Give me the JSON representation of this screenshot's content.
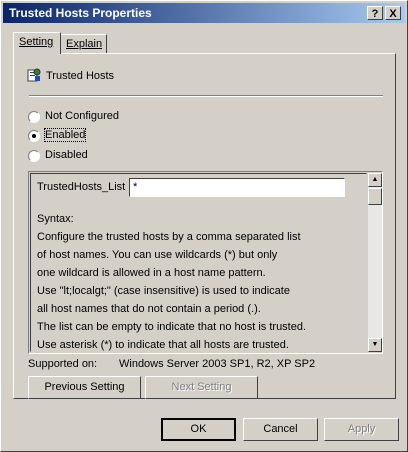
{
  "window": {
    "title": "Trusted Hosts Properties",
    "help_button": "?",
    "close_button": "X"
  },
  "tabs": [
    {
      "label": "Setting",
      "active": true
    },
    {
      "label": "Explain",
      "active": false
    }
  ],
  "policy": {
    "name": "Trusted Hosts",
    "icon": "policy-setting-icon"
  },
  "radios": [
    {
      "label": "Not Configured",
      "selected": false
    },
    {
      "label": "Enabled",
      "selected": true
    },
    {
      "label": "Disabled",
      "selected": false
    }
  ],
  "option": {
    "label": "TrustedHosts_List",
    "value": "*"
  },
  "description": [
    "Syntax:",
    "Configure the trusted hosts by a comma separated list",
    "of host names. You can use wildcards (*) but only",
    "one wildcard is allowed in a host name pattern.",
    "Use \"lt;localgt;\" (case insensitive) is used to indicate",
    "all host names that do not contain a period (.).",
    "The list can be empty to indicate that no host is trusted.",
    "Use asterisk (*)  to indicate that all hosts are trusted."
  ],
  "supported": {
    "label": "Supported on:",
    "value": "Windows Server 2003 SP1, R2, XP SP2"
  },
  "nav": {
    "previous": "Previous Setting",
    "next": "Next Setting"
  },
  "footer": {
    "ok": "OK",
    "cancel": "Cancel",
    "apply": "Apply"
  },
  "colors": {
    "titlebar_start": "#0a246a",
    "titlebar_end": "#a6caf0",
    "face": "#d4d0c8"
  }
}
